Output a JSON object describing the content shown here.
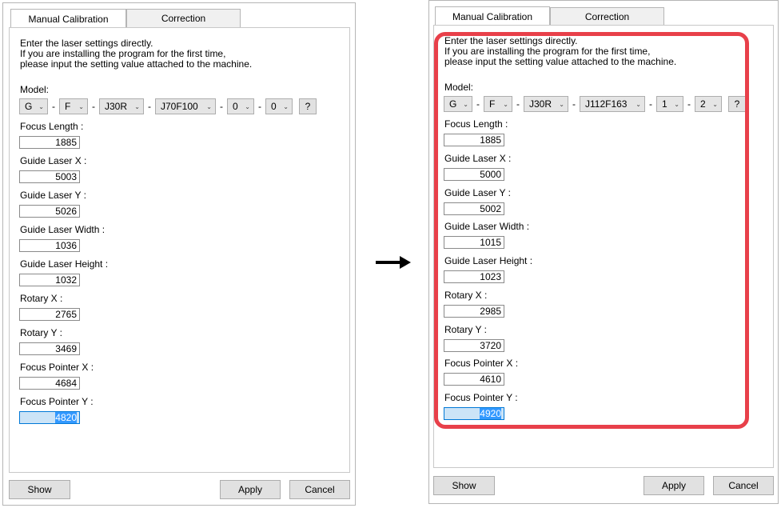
{
  "tabs": [
    "Manual Calibration",
    "Correction"
  ],
  "intro": {
    "line1": "Enter the laser settings directly.",
    "line2": "If you are installing the program for the first time,",
    "line3": "please input the setting value attached to the machine."
  },
  "labels": {
    "model": "Model:",
    "focus_length": "Focus Length :",
    "guide_x": "Guide Laser X :",
    "guide_y": "Guide Laser Y :",
    "guide_w": "Guide Laser Width :",
    "guide_h": "Guide Laser Height :",
    "rotary_x": "Rotary X :",
    "rotary_y": "Rotary Y :",
    "fp_x": "Focus Pointer X :",
    "fp_y": "Focus Pointer Y :"
  },
  "dash": "-",
  "help": "?",
  "buttons": {
    "show": "Show",
    "apply": "Apply",
    "cancel": "Cancel"
  },
  "left": {
    "model": [
      "G",
      "F",
      "J30R",
      "J70F100",
      "0",
      "0"
    ],
    "values": {
      "focus_length": "1885",
      "guide_x": "5003",
      "guide_y": "5026",
      "guide_w": "1036",
      "guide_h": "1032",
      "rotary_x": "2765",
      "rotary_y": "3469",
      "fp_x": "4684",
      "fp_y": "4820"
    }
  },
  "right": {
    "model": [
      "G",
      "F",
      "J30R",
      "J112F163",
      "1",
      "2"
    ],
    "values": {
      "focus_length": "1885",
      "guide_x": "5000",
      "guide_y": "5002",
      "guide_w": "1015",
      "guide_h": "1023",
      "rotary_x": "2985",
      "rotary_y": "3720",
      "fp_x": "4610",
      "fp_y": "4920"
    }
  },
  "colors": {
    "highlight": "#e8404a",
    "selection": "#3399ff"
  },
  "icons": {
    "arrow": "right-arrow-icon",
    "dropdown": "chevron-down-icon"
  }
}
